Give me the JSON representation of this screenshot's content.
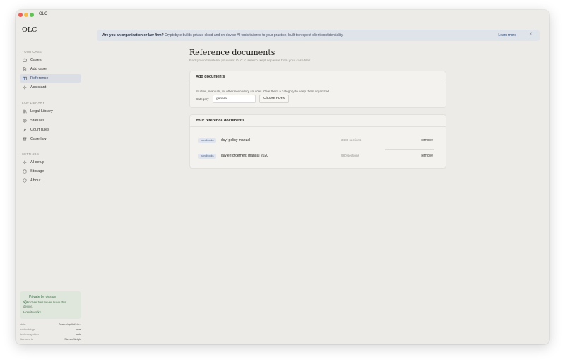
{
  "window": {
    "title": "OLC"
  },
  "sidebar": {
    "brand": "OLC",
    "sections": [
      {
        "label": "YOUR CASE",
        "items": [
          {
            "label": "Cases",
            "icon": "briefcase-icon",
            "active": false
          },
          {
            "label": "Add case",
            "icon": "file-plus-icon",
            "active": false
          },
          {
            "label": "Reference",
            "icon": "book-open-icon",
            "active": true
          },
          {
            "label": "Assistant",
            "icon": "sparkle-icon",
            "active": false
          }
        ]
      },
      {
        "label": "LAW LIBRARY",
        "items": [
          {
            "label": "Legal Library",
            "icon": "library-icon",
            "active": false
          },
          {
            "label": "Statutes",
            "icon": "globe-icon",
            "active": false
          },
          {
            "label": "Court rules",
            "icon": "gavel-icon",
            "active": false
          },
          {
            "label": "Case law",
            "icon": "archive-icon",
            "active": false
          }
        ]
      },
      {
        "label": "SETTINGS",
        "items": [
          {
            "label": "AI setup",
            "icon": "sparkle-icon",
            "active": false
          },
          {
            "label": "Storage",
            "icon": "database-icon",
            "active": false
          },
          {
            "label": "About",
            "icon": "shield-icon",
            "active": false
          }
        ]
      }
    ],
    "privacy": {
      "title": "Private by design",
      "text": "Your case files never leave this device.",
      "link": "How it works"
    },
    "meta": [
      {
        "key": "data",
        "value": "/Users/cyclist/Lib..."
      },
      {
        "key": "embeddings",
        "value": "local"
      },
      {
        "key": "text recognition",
        "value": "auto"
      },
      {
        "key": "licensed to",
        "value": "Steven Wright"
      }
    ]
  },
  "banner": {
    "bold": "Are you an organization or law firm?",
    "text": " Cryptobyte builds private cloud and on-device AI tools tailored to your practice, built to respect client confidentiality.",
    "link": "Learn more",
    "close": "×"
  },
  "main": {
    "title": "Reference documents",
    "subtitle": "Background material you want OLC to search, kept separate from your case files.",
    "add_card": {
      "title": "Add documents",
      "description": "Studies, manuals, or other secondary sources. Give them a category to keep them organized.",
      "category_label": "Category",
      "category_value": "general",
      "choose_button": "Choose PDFs"
    },
    "docs_card": {
      "title": "Your reference documents",
      "documents": [
        {
          "tag": "handbooks",
          "name": "dcyf policy manual",
          "sections": "3480 sections",
          "action": "remove"
        },
        {
          "tag": "handbooks",
          "name": "law enforcement manual 2020",
          "sections": "980 sections",
          "action": "remove"
        }
      ]
    }
  },
  "colors": {
    "background": "#ecebe7",
    "accent": "#2f4c7a",
    "active_nav": "#dcdee5",
    "privacy_bg": "#dfe6dc",
    "banner_bg": "#dfe3ea"
  }
}
